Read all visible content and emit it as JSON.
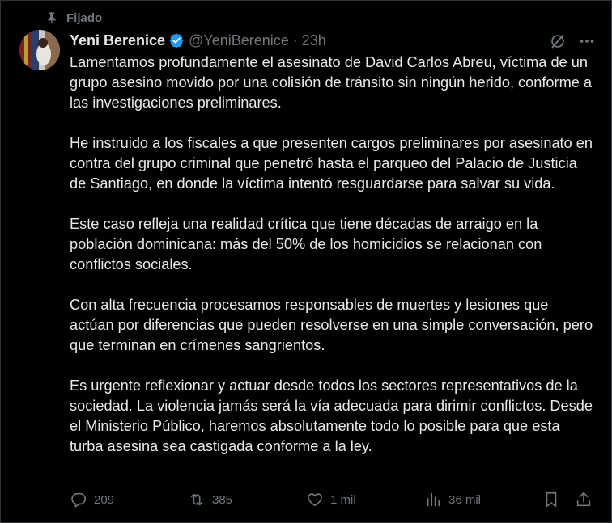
{
  "pinned_label": "Fijado",
  "author": {
    "name": "Yeni Berenice",
    "handle": "@YeniBerenice",
    "separator": "·",
    "time": "23h"
  },
  "post": {
    "paragraphs": [
      "Lamentamos profundamente el asesinato de David Carlos Abreu, víctima de un grupo asesino movido por una colisión de tránsito sin ningún herido, conforme a las investigaciones preliminares.",
      "He instruido a los fiscales a que presenten cargos preliminares por asesinato en contra del grupo criminal que penetró hasta el parqueo del Palacio de Justicia de Santiago, en donde la víctima intentó resguardarse para salvar su vida.",
      "Este caso refleja una realidad crítica que tiene décadas de arraigo en la población dominicana: más del 50% de los homicidios se relacionan con conflictos sociales.",
      "Con alta frecuencia procesamos responsables de muertes y lesiones que actúan por diferencias que pueden resolverse en una simple conversación, pero que terminan en crímenes sangrientos.",
      "Es urgente reflexionar y actuar desde todos los sectores representativos de la sociedad. La violencia jamás será la vía adecuada para dirimir conflictos. Desde el Ministerio Público, haremos absolutamente todo lo posible para que esta turba asesina sea castigada conforme a la ley."
    ]
  },
  "metrics": {
    "replies": "209",
    "reposts": "385",
    "likes": "1 mil",
    "views": "36 mil"
  },
  "icons": {
    "pin": "pin-icon",
    "verified": "verified-badge-icon",
    "grok": "grok-icon",
    "more": "more-icon",
    "reply": "reply-icon",
    "repost": "repost-icon",
    "like": "heart-icon",
    "views": "views-icon",
    "bookmark": "bookmark-icon",
    "share": "share-icon"
  },
  "colors": {
    "background": "#000000",
    "text": "#e7e9ea",
    "muted": "#71767b",
    "verified": "#1d9bf0"
  }
}
